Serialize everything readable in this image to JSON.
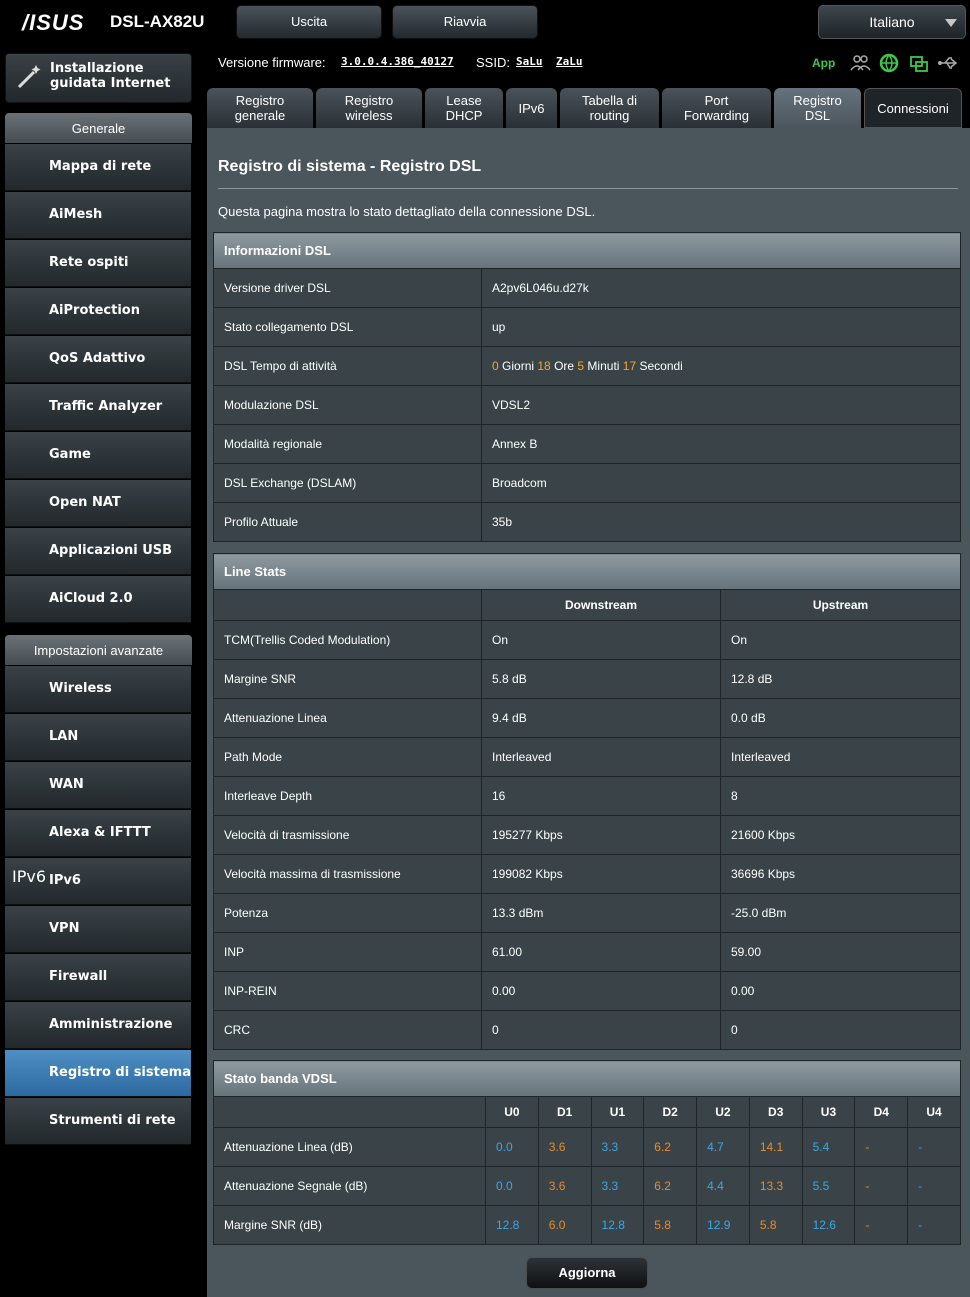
{
  "header": {
    "brand": "/ISUS",
    "model": "DSL-AX82U",
    "logout_label": "Uscita",
    "reboot_label": "Riavvia",
    "language": "Italiano"
  },
  "infobar": {
    "firmware_label": "Versione firmware:",
    "firmware_value": "3.0.0.4.386_40127",
    "ssid_label": "SSID:",
    "ssid_1": "SaLu",
    "ssid_2": "ZaLu",
    "app_label": "App"
  },
  "sidebar": {
    "quick_setup": "Installazione guidata Internet",
    "general_header": "Generale",
    "general_items": [
      {
        "label": "Mappa di rete",
        "icon": "network-map-icon"
      },
      {
        "label": "AiMesh",
        "icon": "aimesh-icon"
      },
      {
        "label": "Rete ospiti",
        "icon": "guest-network-icon"
      },
      {
        "label": "AiProtection",
        "icon": "aiprotection-icon"
      },
      {
        "label": "QoS Adattivo",
        "icon": "qos-icon"
      },
      {
        "label": "Traffic Analyzer",
        "icon": "traffic-analyzer-icon"
      },
      {
        "label": "Game",
        "icon": "game-icon"
      },
      {
        "label": "Open NAT",
        "icon": "open-nat-icon"
      },
      {
        "label": "Applicazioni USB",
        "icon": "usb-icon"
      },
      {
        "label": "AiCloud 2.0",
        "icon": "aicloud-icon"
      }
    ],
    "advanced_header": "Impostazioni avanzate",
    "advanced_items": [
      {
        "label": "Wireless",
        "icon": "wireless-icon"
      },
      {
        "label": "LAN",
        "icon": "lan-icon"
      },
      {
        "label": "WAN",
        "icon": "wan-icon"
      },
      {
        "label": "Alexa & IFTTT",
        "icon": "alexa-icon"
      },
      {
        "label": "IPv6",
        "icon": "ipv6-icon"
      },
      {
        "label": "VPN",
        "icon": "vpn-icon"
      },
      {
        "label": "Firewall",
        "icon": "firewall-icon"
      },
      {
        "label": "Amministrazione",
        "icon": "admin-gear-icon"
      },
      {
        "label": "Registro di sistema",
        "icon": "system-log-icon"
      },
      {
        "label": "Strumenti di rete",
        "icon": "network-tools-icon"
      }
    ]
  },
  "tabs": [
    {
      "l1": "Registro",
      "l2": "generale"
    },
    {
      "l1": "Registro",
      "l2": "wireless"
    },
    {
      "l1": "Lease",
      "l2": "DHCP"
    },
    {
      "l1": "IPv6",
      "l2": ""
    },
    {
      "l1": "Tabella di",
      "l2": "routing"
    },
    {
      "l1": "Port",
      "l2": "Forwarding"
    },
    {
      "l1": "Registro",
      "l2": "DSL"
    },
    {
      "l1": "Connessioni",
      "l2": ""
    }
  ],
  "page": {
    "title": "Registro di sistema - Registro DSL",
    "description": "Questa pagina mostra lo stato dettagliato della connessione DSL.",
    "refresh_label": "Aggiorna"
  },
  "dsl_info": {
    "header": "Informazioni DSL",
    "driver_label": "Versione driver DSL",
    "driver_value": "A2pv6L046u.d27k",
    "link_label": "Stato collegamento DSL",
    "link_value": "up",
    "uptime_label": "DSL Tempo di attività",
    "uptime_days": "0",
    "uptime_days_unit": " Giorni ",
    "uptime_hours": "18",
    "uptime_hours_unit": " Ore ",
    "uptime_minutes": "5",
    "uptime_minutes_unit": " Minuti ",
    "uptime_seconds": "17",
    "uptime_seconds_unit": " Secondi",
    "modulation_label": "Modulazione DSL",
    "modulation_value": "VDSL2",
    "annex_label": "Modalità regionale",
    "annex_value": "Annex B",
    "exchange_label": "DSL Exchange (DSLAM)",
    "exchange_value": "Broadcom",
    "profile_label": "Profilo Attuale",
    "profile_value": "35b"
  },
  "line_stats": {
    "header": "Line Stats",
    "col_down": "Downstream",
    "col_up": "Upstream",
    "rows": [
      {
        "label": "TCM(Trellis Coded Modulation)",
        "down": "On",
        "up": "On"
      },
      {
        "label": "Margine SNR",
        "down": "5.8 dB",
        "up": "12.8 dB"
      },
      {
        "label": "Attenuazione Linea",
        "down": "9.4 dB",
        "up": "0.0 dB"
      },
      {
        "label": "Path Mode",
        "down": "Interleaved",
        "up": "Interleaved"
      },
      {
        "label": "Interleave Depth",
        "down": "16",
        "up": "8"
      },
      {
        "label": "Velocità di trasmissione",
        "down": "195277 Kbps",
        "up": "21600 Kbps"
      },
      {
        "label": "Velocità massima di trasmissione",
        "down": "199082 Kbps",
        "up": "36696 Kbps"
      },
      {
        "label": "Potenza",
        "down": "13.3 dBm",
        "up": "-25.0 dBm"
      },
      {
        "label": "INP",
        "down": "61.00",
        "up": "59.00"
      },
      {
        "label": "INP-REIN",
        "down": "0.00",
        "up": "0.00"
      },
      {
        "label": "CRC",
        "down": "0",
        "up": "0"
      }
    ]
  },
  "vdsl_band": {
    "header": "Stato banda VDSL",
    "bands": [
      "U0",
      "D1",
      "U1",
      "D2",
      "U2",
      "D3",
      "U3",
      "D4",
      "U4"
    ],
    "rows": [
      {
        "label": "Attenuazione Linea (dB)",
        "values": [
          "0.0",
          "3.6",
          "3.3",
          "6.2",
          "4.7",
          "14.1",
          "5.4",
          "-",
          "-"
        ]
      },
      {
        "label": "Attenuazione Segnale (dB)",
        "values": [
          "0.0",
          "3.6",
          "3.3",
          "6.2",
          "4.4",
          "13.3",
          "5.5",
          "-",
          "-"
        ]
      },
      {
        "label": "Margine SNR (dB)",
        "values": [
          "12.8",
          "6.0",
          "12.8",
          "5.8",
          "12.9",
          "5.8",
          "12.6",
          "-",
          "-"
        ]
      }
    ],
    "upstream_color": "#3ea7e4",
    "downstream_color": "#e88c2e"
  }
}
